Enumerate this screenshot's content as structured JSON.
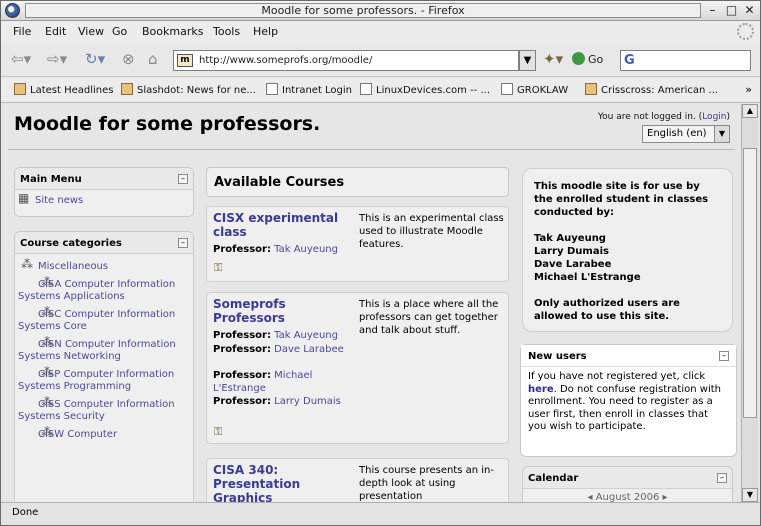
{
  "window": {
    "title": "Moodle for some professors. - Firefox"
  },
  "menubar": [
    "File",
    "Edit",
    "View",
    "Go",
    "Bookmarks",
    "Tools",
    "Help"
  ],
  "toolbar": {
    "url": "http://www.someprofs.org/moodle/",
    "go_label": "Go"
  },
  "bookmarks": [
    {
      "label": "Latest Headlines",
      "icon": "rss-icon"
    },
    {
      "label": "Slashdot: News for ne...",
      "icon": "rss-icon"
    },
    {
      "label": "Intranet Login",
      "icon": "page-icon"
    },
    {
      "label": "LinuxDevices.com -- ...",
      "icon": "page-icon"
    },
    {
      "label": "GROKLAW",
      "icon": "page-icon"
    },
    {
      "label": "Crisscross: American ...",
      "icon": "rss-icon"
    }
  ],
  "page": {
    "title": "Moodle for some professors.",
    "login_prefix": "You are not logged in. (",
    "login_link": "Login",
    "login_suffix": ")",
    "language": "English (en)"
  },
  "main_menu": {
    "title": "Main Menu",
    "items": [
      "Site news"
    ]
  },
  "course_categories": {
    "title": "Course categories",
    "items": [
      "Miscellaneous",
      "CISA Computer Information Systems Applications",
      "CISC Computer Information Systems Core",
      "CISN Computer Information Systems Networking",
      "CISP Computer Information Systems Programming",
      "CISS Computer Information Systems Security",
      "CISW Computer"
    ]
  },
  "courses": {
    "title": "Available Courses",
    "prof_label": "Professor:",
    "list": [
      {
        "name": "CISX experimental class",
        "professors": [
          "Tak Auyeung"
        ],
        "description": "This is an experimental class used to illustrate Moodle features."
      },
      {
        "name": "Someprofs Professors",
        "professors": [
          "Tak Auyeung",
          "Dave Larabee",
          "Michael L'Estrange",
          "Larry Dumais"
        ],
        "description": "This is a place where all the professors can get together and talk about stuff."
      },
      {
        "name": "CISA 340: Presentation Graphics",
        "professors": [],
        "description": "This course presents an in-depth look at using presentation"
      }
    ]
  },
  "site_info": {
    "intro": "This moodle site is for use by the enrolled student in classes conducted by:",
    "people": [
      "Tak Auyeung",
      "Larry Dumais",
      "Dave Larabee",
      "Michael L'Estrange"
    ],
    "note": "Only authorized users are allowed to use this site."
  },
  "new_users": {
    "title": "New users",
    "text_before": "If you have not registered yet, click ",
    "link": "here",
    "text_after": ". Do not confuse registration with enrollment. You need to register as a user first, then enroll in classes that you wish to participate."
  },
  "calendar": {
    "title": "Calendar",
    "month": "August 2006"
  },
  "status": "Done"
}
